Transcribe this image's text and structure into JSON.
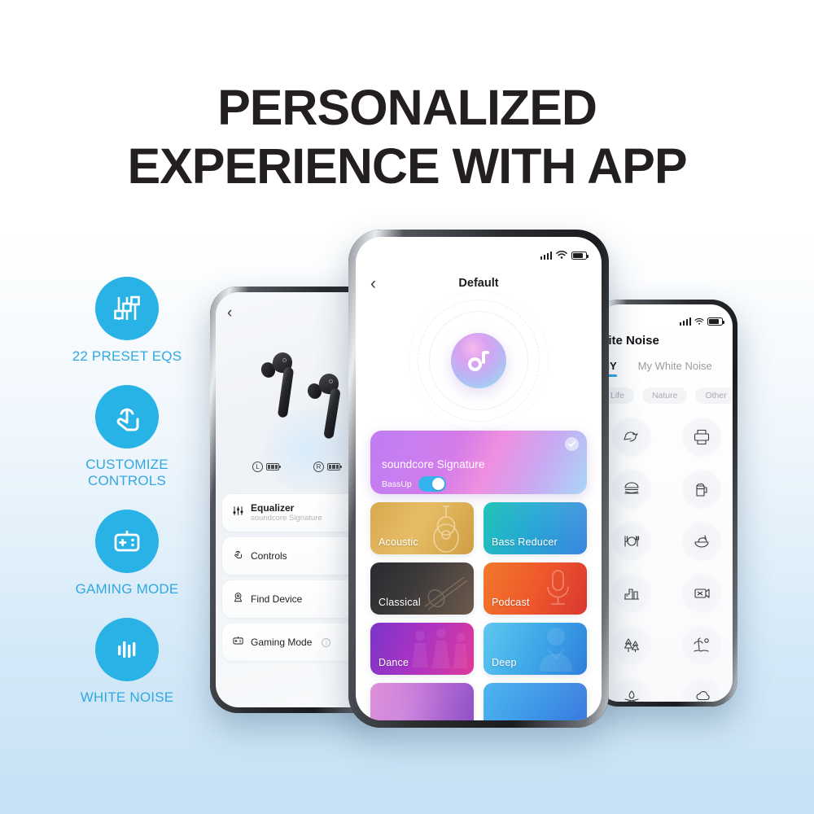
{
  "headline": {
    "line1": "PERSONALIZED",
    "line2": "EXPERIENCE WITH APP"
  },
  "colors": {
    "accent_blue": "#29b2e5",
    "label_blue": "#32a8e0",
    "headline_dark": "#231f20",
    "toggle_on": "#35b3ef",
    "tab_underline": "#2fa8e0",
    "background_top": "#ffffff",
    "background_bottom": "#c5e1f4"
  },
  "features": [
    {
      "label": "22 PRESET EQS",
      "icon": "equalizer-sliders-icon"
    },
    {
      "label": "CUSTOMIZE\nCONTROLS",
      "label_line1": "CUSTOMIZE",
      "label_line2": "CONTROLS",
      "icon": "tap-gesture-icon"
    },
    {
      "label": "GAMING MODE",
      "icon": "gamepad-icon"
    },
    {
      "label": "WHITE NOISE",
      "icon": "sound-wave-bars-icon"
    }
  ],
  "left_phone": {
    "back_icon": "chevron-left-icon",
    "product_image": "black-earbuds-image",
    "battery": [
      {
        "side": "L",
        "icon": "battery-icon"
      },
      {
        "side": "R",
        "icon": "battery-icon"
      }
    ],
    "menu": [
      {
        "title": "Equalizer",
        "subtitle": "soundcore Signature",
        "icon": "equalizer-icon"
      },
      {
        "title": "Controls",
        "subtitle": "",
        "icon": "tap-gesture-icon"
      },
      {
        "title": "Find Device",
        "subtitle": "",
        "icon": "location-pin-icon"
      },
      {
        "title": "Gaming Mode",
        "subtitle": "",
        "icon": "gamepad-icon",
        "info": "i"
      }
    ]
  },
  "center_phone": {
    "status_bar": {
      "signal_icon": "signal-bars-icon",
      "wifi_icon": "wifi-icon",
      "battery_icon": "battery-icon"
    },
    "back_icon": "chevron-left-icon",
    "title": "Default",
    "logo": "soundcore-logo-orb",
    "active_card": {
      "name": "soundcore Signature",
      "bass_label": "BassUp",
      "bass_enabled": true,
      "selected": true,
      "check_icon": "check-circle-icon"
    },
    "presets": [
      {
        "name": "Acoustic",
        "theme": "t-acoustic",
        "art": "guitar"
      },
      {
        "name": "Bass Reducer",
        "theme": "t-bassreducer",
        "art": "none"
      },
      {
        "name": "Classical",
        "theme": "t-classical",
        "art": "violin"
      },
      {
        "name": "Podcast",
        "theme": "t-podcast",
        "art": "mic"
      },
      {
        "name": "Dance",
        "theme": "t-dance",
        "art": "dancers"
      },
      {
        "name": "Deep",
        "theme": "t-deep",
        "art": "person"
      },
      {
        "name": "",
        "theme": "t-row4a",
        "art": "none"
      },
      {
        "name": "",
        "theme": "t-row4b",
        "art": "none"
      }
    ]
  },
  "right_phone": {
    "status_bar": {
      "signal_icon": "signal-bars-icon",
      "wifi_icon": "wifi-icon",
      "battery_icon": "battery-icon"
    },
    "title": "White Noise",
    "tabs": [
      {
        "label": "DIY",
        "active": true
      },
      {
        "label": "My White Noise",
        "active": false
      }
    ],
    "chips": [
      "Life",
      "Nature",
      "Other"
    ],
    "sounds": [
      {
        "icon": "bird-icon"
      },
      {
        "icon": "printer-icon"
      },
      {
        "icon": "burger-icon"
      },
      {
        "icon": "beer-mug-icon"
      },
      {
        "icon": "plate-cutlery-icon"
      },
      {
        "icon": "salad-bowl-icon"
      },
      {
        "icon": "city-buildings-icon"
      },
      {
        "icon": "projector-icon"
      },
      {
        "icon": "forest-trees-icon"
      },
      {
        "icon": "palm-beach-icon"
      },
      {
        "icon": "campfire-icon"
      },
      {
        "icon": "rain-icon"
      }
    ]
  }
}
